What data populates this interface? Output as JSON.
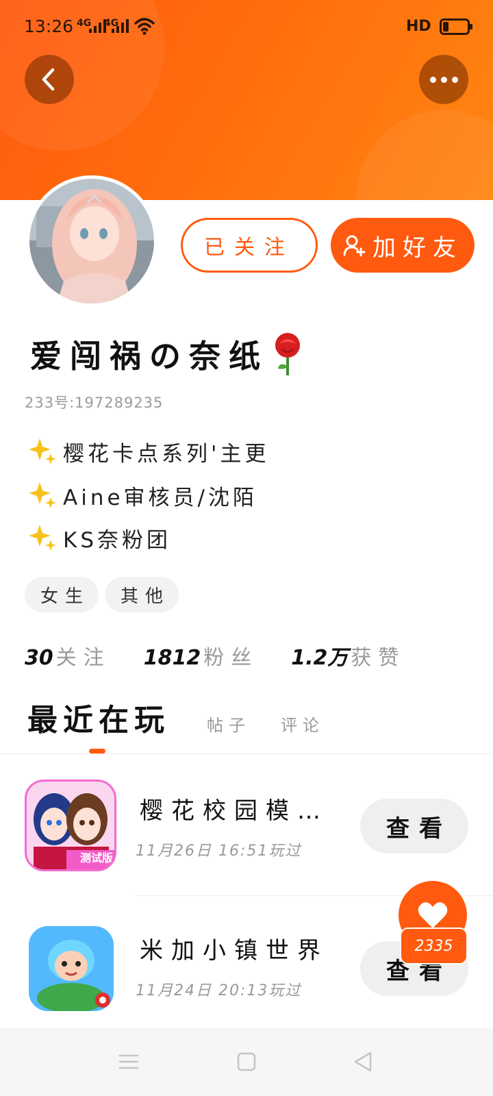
{
  "status_bar": {
    "time": "13:26",
    "network_1": "4G",
    "network_2": "4G",
    "hd": "HD",
    "icons": [
      "signal-icon",
      "wifi-icon",
      "battery-icon"
    ]
  },
  "header": {
    "back_icon": "back-arrow-icon",
    "more_icon": "more-dots-icon",
    "accent_color": "#ff5a0f"
  },
  "actions": {
    "follow_label": "已关注",
    "add_friend_label": "加好友",
    "add_friend_icon": "add-person-icon"
  },
  "profile": {
    "username": "爱闯祸の奈纸",
    "username_emoji": "rose-icon",
    "user_id": "233号:197289235",
    "bio_lines": [
      {
        "icon": "sparkle-icon",
        "text": "樱花卡点系列'主更"
      },
      {
        "icon": "sparkle-icon",
        "text": "Aine审核员/沈陌"
      },
      {
        "icon": "sparkle-icon",
        "text": "KS奈粉团"
      }
    ],
    "tags": [
      "女生",
      "其他"
    ]
  },
  "stats": {
    "following_count": "30",
    "following_label": "关注",
    "fans_count": "1812",
    "fans_label": "粉丝",
    "likes_count": "1.2万",
    "likes_label": "获赞"
  },
  "tabs": {
    "active": "最近在玩",
    "items": [
      "帖子",
      "评论"
    ]
  },
  "games": [
    {
      "title": "樱花校园模…",
      "time": "11月26日 16:51玩过",
      "button": "查看",
      "badge": "测试版"
    },
    {
      "title": "米加小镇世界",
      "time": "11月24日 20:13玩过",
      "button": "查看"
    }
  ],
  "like_fab": {
    "count": "2335",
    "icon": "heart-icon"
  },
  "nav_bar": {
    "icons": [
      "menu-icon",
      "home-square-icon",
      "back-triangle-icon"
    ]
  }
}
